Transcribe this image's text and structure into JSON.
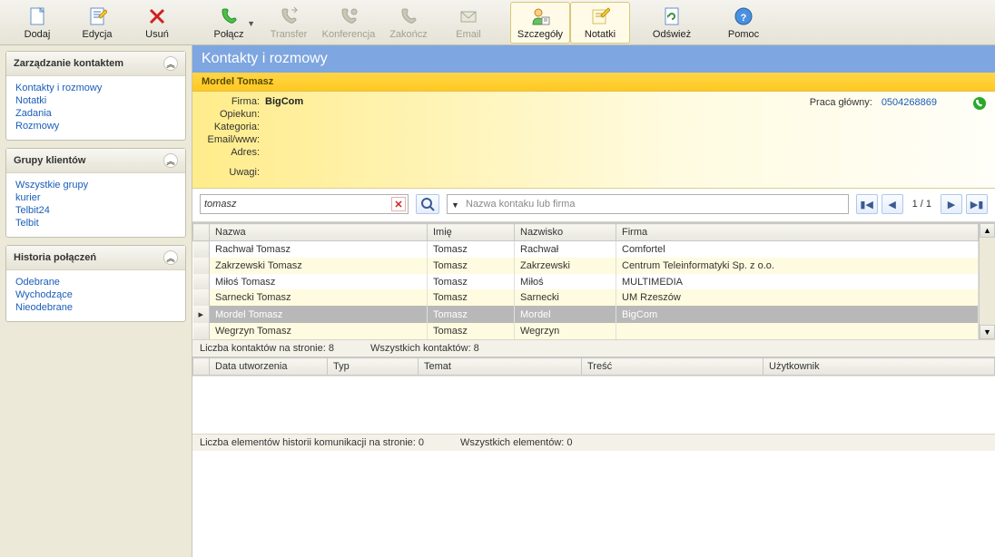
{
  "toolbar": {
    "add": "Dodaj",
    "edit": "Edycja",
    "delete": "Usuń",
    "connect": "Połącz",
    "transfer": "Transfer",
    "conference": "Konferencja",
    "end": "Zakończ",
    "email": "Email",
    "details": "Szczegóły",
    "notes": "Notatki",
    "refresh": "Odśwież",
    "help": "Pomoc"
  },
  "sidebar": {
    "p1": {
      "title": "Zarządzanie kontaktem",
      "items": [
        "Kontakty i rozmowy",
        "Notatki",
        "Zadania",
        "Rozmowy"
      ]
    },
    "p2": {
      "title": "Grupy klientów",
      "items": [
        "Wszystkie grupy",
        "kurier",
        "Telbit24",
        "Telbit"
      ]
    },
    "p3": {
      "title": "Historia połączeń",
      "items": [
        "Odebrane",
        "Wychodzące",
        "Nieodebrane"
      ]
    }
  },
  "header": {
    "title": "Kontakty i rozmowy"
  },
  "card": {
    "name": "Mordel Tomasz",
    "flbl": {
      "firma": "Firma:",
      "opiekun": "Opiekun:",
      "kategoria": "Kategoria:",
      "email": "Email/www:",
      "adres": "Adres:",
      "uwagi": "Uwagi:"
    },
    "firma": "BigCom",
    "call_lbl": "Praca główny:",
    "call_num": "0504268869"
  },
  "search": {
    "value": "tomasz",
    "placeholder": "Nazwa kontaku lub firma"
  },
  "pager": {
    "info": "1 / 1"
  },
  "grid": {
    "cols": [
      "Nazwa",
      "Imię",
      "Nazwisko",
      "Firma"
    ],
    "rows": [
      [
        "Rachwał Tomasz",
        "Tomasz",
        "Rachwał",
        "Comfortel"
      ],
      [
        "Zakrzewski Tomasz",
        "Tomasz",
        "Zakrzewski",
        "Centrum Teleinformatyki Sp. z o.o."
      ],
      [
        "Miłoś Tomasz",
        "Tomasz",
        "Miłoś",
        "MULTIMEDIA"
      ],
      [
        "Sarnecki Tomasz",
        "Tomasz",
        "Sarnecki",
        "UM Rzeszów"
      ],
      [
        "Mordel Tomasz",
        "Tomasz",
        "Mordel",
        "BigCom"
      ],
      [
        "Wegrzyn Tomasz",
        "Tomasz",
        "Wegrzyn",
        ""
      ]
    ],
    "selected": 4
  },
  "status1": {
    "a": "Liczba kontaktów na stronie: 8",
    "b": "Wszystkich kontaktów: 8"
  },
  "grid2": {
    "cols": [
      "Data utworzenia",
      "Typ",
      "Temat",
      "Treść",
      "Użytkownik"
    ]
  },
  "status2": {
    "a": "Liczba elementów historii komunikacji na stronie: 0",
    "b": "Wszystkich elementów: 0"
  }
}
